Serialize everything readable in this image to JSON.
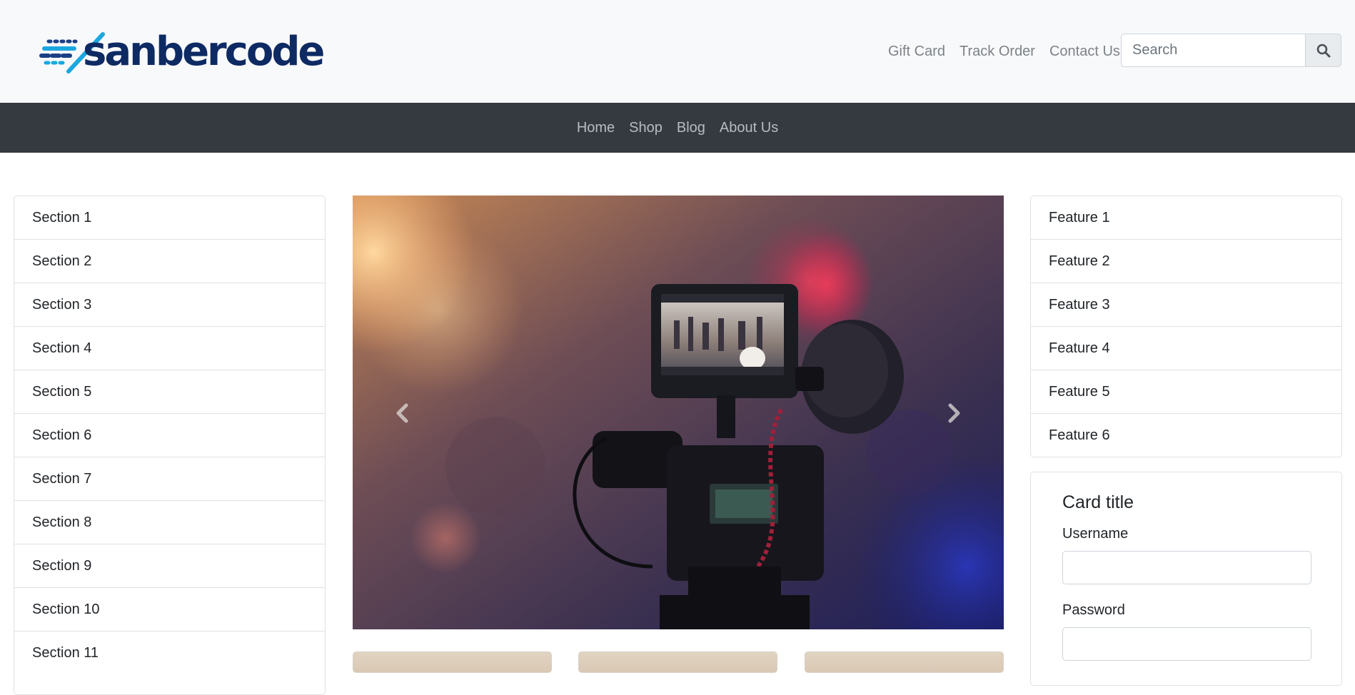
{
  "header": {
    "logo_text": "sanbercode",
    "top_links": [
      "Gift Card",
      "Track Order",
      "Contact Us"
    ],
    "search": {
      "placeholder": "Search",
      "value": ""
    }
  },
  "nav": {
    "items": [
      "Home",
      "Shop",
      "Blog",
      "About Us"
    ]
  },
  "sidebar_left": {
    "items": [
      "Section 1",
      "Section 2",
      "Section 3",
      "Section 4",
      "Section 5",
      "Section 6",
      "Section 7",
      "Section 8",
      "Section 9",
      "Section 10",
      "Section 11"
    ]
  },
  "sidebar_right": {
    "items": [
      "Feature 1",
      "Feature 2",
      "Feature 3",
      "Feature 4",
      "Feature 5",
      "Feature 6"
    ]
  },
  "login_card": {
    "title": "Card title",
    "username_label": "Username",
    "password_label": "Password",
    "username_value": "",
    "password_value": ""
  },
  "icons": {
    "search": "search-icon",
    "prev": "chevron-left-icon",
    "next": "chevron-right-icon"
  },
  "colors": {
    "header_bg": "#f8f9fa",
    "nav_bg": "#343a40",
    "logo_dark": "#0e2a63",
    "logo_accent": "#1aa7e0"
  }
}
